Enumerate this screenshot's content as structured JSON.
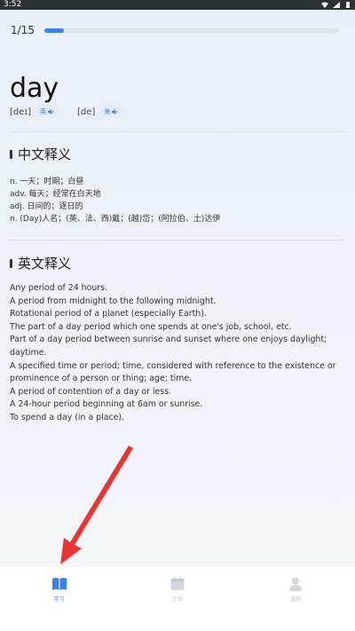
{
  "status_bar": {
    "time": "3:52"
  },
  "progress": {
    "text": "1/15",
    "fraction": 0.0667
  },
  "word": {
    "text": "day"
  },
  "phonetics": [
    {
      "symbol": "[deɪ]",
      "badge": "英"
    },
    {
      "symbol": "[de]",
      "badge": "美"
    }
  ],
  "zh_section": {
    "title": "中文释义",
    "items": [
      "n. 一天；时期；白昼",
      "adv. 每天；经常在白天地",
      "adj. 日间的；逐日的",
      "n. (Day)人名；(英、法、西)戴；(越)岱；(阿拉伯、土)达伊"
    ]
  },
  "en_section": {
    "title": "英文释义",
    "items": [
      "Any period of 24 hours.",
      "A period from midnight to the following midnight.",
      "Rotational period of a planet (especially Earth).",
      "The part of a day period which one spends at one's job, school, etc.",
      "Part of a day period between sunrise and sunset where one enjoys daylight; daytime.",
      "A specified time or period; time, considered with reference to the existence or prominence of a person or thing; age; time.",
      "A period of contention of a day or less.",
      "A 24-hour period beginning at 6am or sunrise.",
      "To spend a day (in a place)."
    ]
  },
  "nav": {
    "items": [
      {
        "label": "学习",
        "icon": "book-icon",
        "active": true
      },
      {
        "label": "计划",
        "icon": "calendar-icon",
        "active": false
      },
      {
        "label": "我的",
        "icon": "person-icon",
        "active": false
      }
    ]
  },
  "colors": {
    "accent": "#3c82e6",
    "arrow": "#e8352f"
  }
}
